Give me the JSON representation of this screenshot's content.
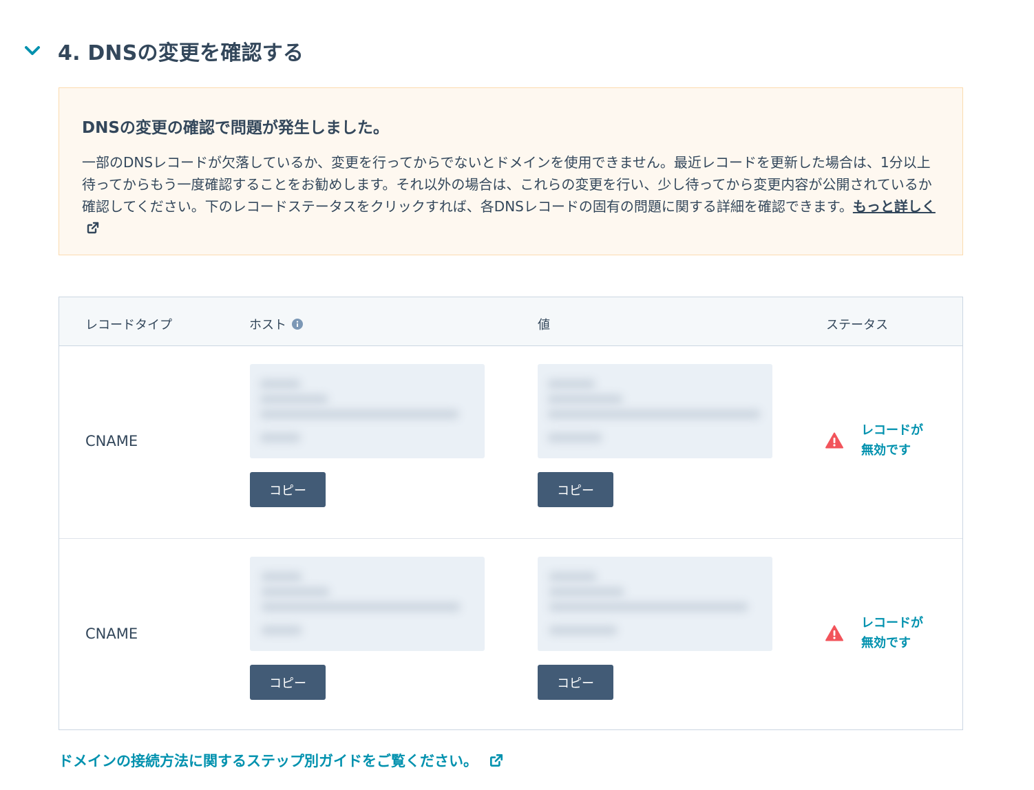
{
  "section": {
    "title": "4. DNSの変更を確認する"
  },
  "alert": {
    "title": "DNSの変更の確認で問題が発生しました。",
    "body": "一部のDNSレコードが欠落しているか、変更を行ってからでないとドメインを使用できません。最近レコードを更新した場合は、1分以上待ってからもう一度確認することをお勧めします。それ以外の場合は、これらの変更を行い、少し待ってから変更内容が公開されているか確認してください。下のレコードステータスをクリックすれば、各DNSレコードの固有の問題に関する詳細を確認できます。",
    "learn_more": "もっと詳しく"
  },
  "table": {
    "headers": {
      "type": "レコードタイプ",
      "host": "ホスト",
      "value": "値",
      "status": "ステータス"
    },
    "rows": [
      {
        "type": "CNAME",
        "copy_label": "コピー",
        "status_line1": "レコードが",
        "status_line2": "無効です"
      },
      {
        "type": "CNAME",
        "copy_label": "コピー",
        "status_line1": "レコードが",
        "status_line2": "無効です"
      }
    ]
  },
  "footer": {
    "guide_link": "ドメインの接続方法に関するステップ別ガイドをご覧ください。"
  },
  "colors": {
    "accent": "#0091ae",
    "text": "#33475b",
    "button": "#425b76",
    "warning": "#f2545b",
    "alert_bg": "#fef8f0",
    "alert_border": "#fbdbaf"
  },
  "icons": {
    "collapse": "chevron-down-icon",
    "info": "info-icon",
    "external": "external-link-icon",
    "warning": "warning-triangle-icon"
  }
}
